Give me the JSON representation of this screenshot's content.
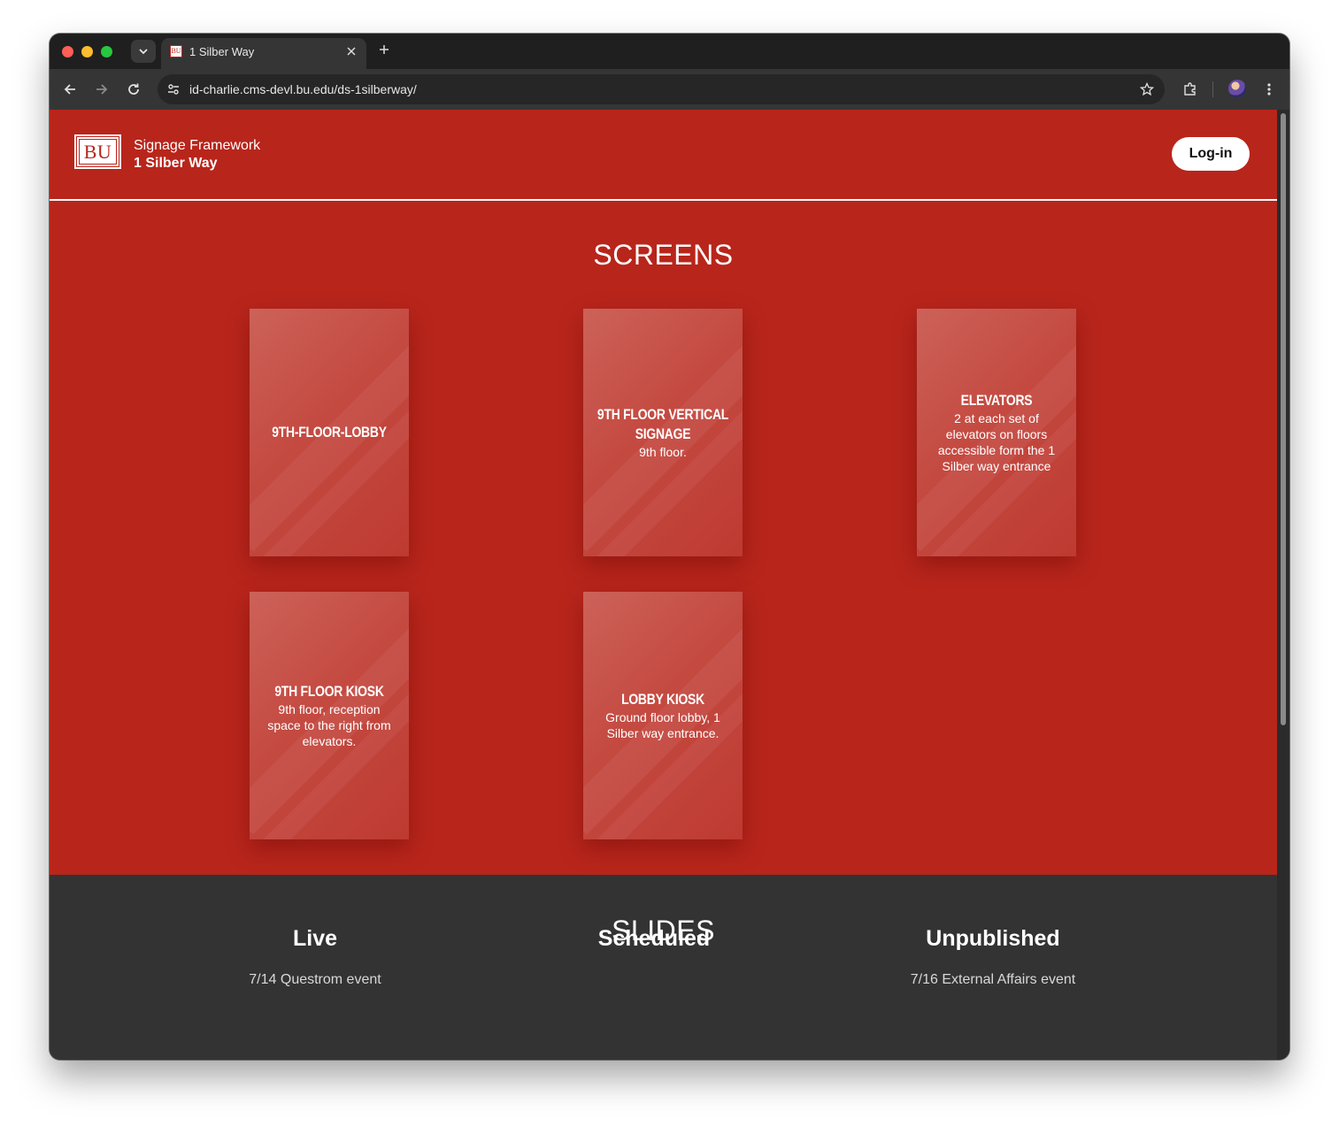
{
  "browser": {
    "tab_title": "1 Silber Way",
    "tab_favicon": "BU",
    "url": "id-charlie.cms-devl.bu.edu/ds-1silberway/"
  },
  "site": {
    "logo_text": "BU",
    "name": "Signage Framework",
    "subtitle": "1 Silber Way",
    "login_label": "Log-in"
  },
  "screens": {
    "heading": "SCREENS",
    "cards": [
      {
        "title": "9TH-FLOOR-LOBBY",
        "description": ""
      },
      {
        "title": "9TH FLOOR VERTICAL SIGNAGE",
        "description": "9th floor."
      },
      {
        "title": "ELEVATORS",
        "description": "2 at each set of elevators on floors accessible form the 1 Silber way entrance"
      },
      {
        "title": "9TH FLOOR KIOSK",
        "description": "9th floor, reception space to the right from elevators."
      },
      {
        "title": "LOBBY KIOSK",
        "description": "Ground floor lobby, 1 Silber way entrance."
      }
    ]
  },
  "slides": {
    "heading": "SLIDES",
    "columns": [
      {
        "title": "Live",
        "items": [
          "7/14 Questrom event"
        ]
      },
      {
        "title": "Scheduled",
        "items": []
      },
      {
        "title": "Unpublished",
        "items": [
          "7/16 External Affairs event"
        ]
      }
    ]
  },
  "colors": {
    "brand_red": "#b8251b",
    "slides_bg": "#333333"
  }
}
